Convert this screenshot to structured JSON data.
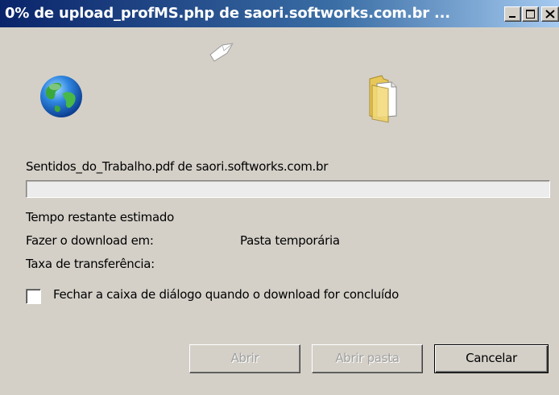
{
  "window": {
    "title": "0% de upload_profMS.php de saori.softworks.com.br ..."
  },
  "icons": {
    "globe": "globe-icon",
    "paper": "flying-paper-icon",
    "folder": "folder-icon"
  },
  "download": {
    "source_text": "Sentidos_do_Trabalho.pdf de saori.softworks.com.br",
    "progress_percent": 0,
    "time_remaining_label": "Tempo restante estimado",
    "download_to_label": "Fazer o download em:",
    "download_to_value": "Pasta temporária",
    "transfer_rate_label": "Taxa de transferência:"
  },
  "options": {
    "close_when_done_label": "Fechar a caixa de diálogo quando o download for concluído",
    "close_when_done_checked": false
  },
  "buttons": {
    "open_label": "Abrir",
    "open_folder_label": "Abrir pasta",
    "cancel_label": "Cancelar"
  },
  "colors": {
    "titlebar_start": "#0a246a",
    "titlebar_end": "#a6caf0",
    "dialog_bg": "#d4d0c8"
  }
}
